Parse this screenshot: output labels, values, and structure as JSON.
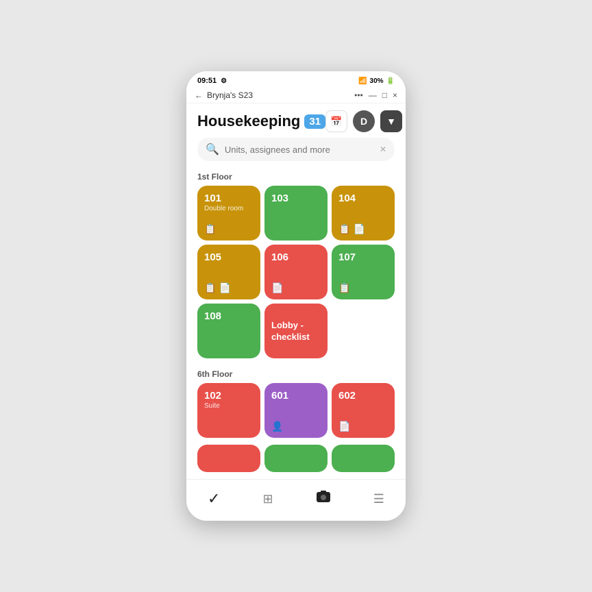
{
  "statusBar": {
    "time": "09:51",
    "settingsIcon": "⚙",
    "batteryLevel": "30%",
    "signal": "📶"
  },
  "windowBar": {
    "title": "Brynja's S23",
    "menuIcon": "•••",
    "minimizeIcon": "—",
    "maximizeIcon": "□",
    "closeIcon": "×",
    "backIcon": "←"
  },
  "header": {
    "title": "Housekeeping",
    "badge": "31",
    "calendarIcon": "calendar",
    "avatarLabel": "D",
    "filterIcon": "filter"
  },
  "search": {
    "placeholder": "Units, assignees and more"
  },
  "floors": [
    {
      "label": "1st Floor",
      "rooms": [
        {
          "id": "r101",
          "number": "101",
          "subtitle": "Double room",
          "color": "amber",
          "icons": [
            "checklist"
          ]
        },
        {
          "id": "r103",
          "number": "103",
          "subtitle": "",
          "color": "green",
          "icons": []
        },
        {
          "id": "r104",
          "number": "104",
          "subtitle": "",
          "color": "amber",
          "icons": [
            "checklist",
            "note"
          ]
        },
        {
          "id": "r105",
          "number": "105",
          "subtitle": "",
          "color": "amber",
          "icons": [
            "checklist",
            "note"
          ]
        },
        {
          "id": "r106",
          "number": "106",
          "subtitle": "",
          "color": "red",
          "icons": [
            "note"
          ]
        },
        {
          "id": "r107",
          "number": "107",
          "subtitle": "",
          "color": "green",
          "icons": [
            "checklist"
          ]
        },
        {
          "id": "r108",
          "number": "108",
          "subtitle": "",
          "color": "green",
          "icons": []
        },
        {
          "id": "lobby",
          "number": "",
          "subtitle": "Lobby - checklist",
          "color": "red",
          "icons": [],
          "isLobby": true
        }
      ]
    },
    {
      "label": "6th Floor",
      "rooms": [
        {
          "id": "r102",
          "number": "102",
          "subtitle": "Suite",
          "color": "red",
          "icons": []
        },
        {
          "id": "r601",
          "number": "601",
          "subtitle": "",
          "color": "purple",
          "icons": [
            "person"
          ]
        },
        {
          "id": "r602",
          "number": "602",
          "subtitle": "",
          "color": "red",
          "icons": [
            "note"
          ]
        }
      ]
    }
  ],
  "partialRow": {
    "colors": [
      "red",
      "green",
      "green"
    ]
  },
  "bottomNav": {
    "items": [
      {
        "id": "nav-tasks",
        "icon": "✓",
        "label": "",
        "active": true
      },
      {
        "id": "nav-grid",
        "icon": "⊞",
        "label": "",
        "active": false
      },
      {
        "id": "nav-camera",
        "icon": "⬤",
        "label": "",
        "active": false
      },
      {
        "id": "nav-list",
        "icon": "☰",
        "label": "",
        "active": false
      }
    ]
  }
}
